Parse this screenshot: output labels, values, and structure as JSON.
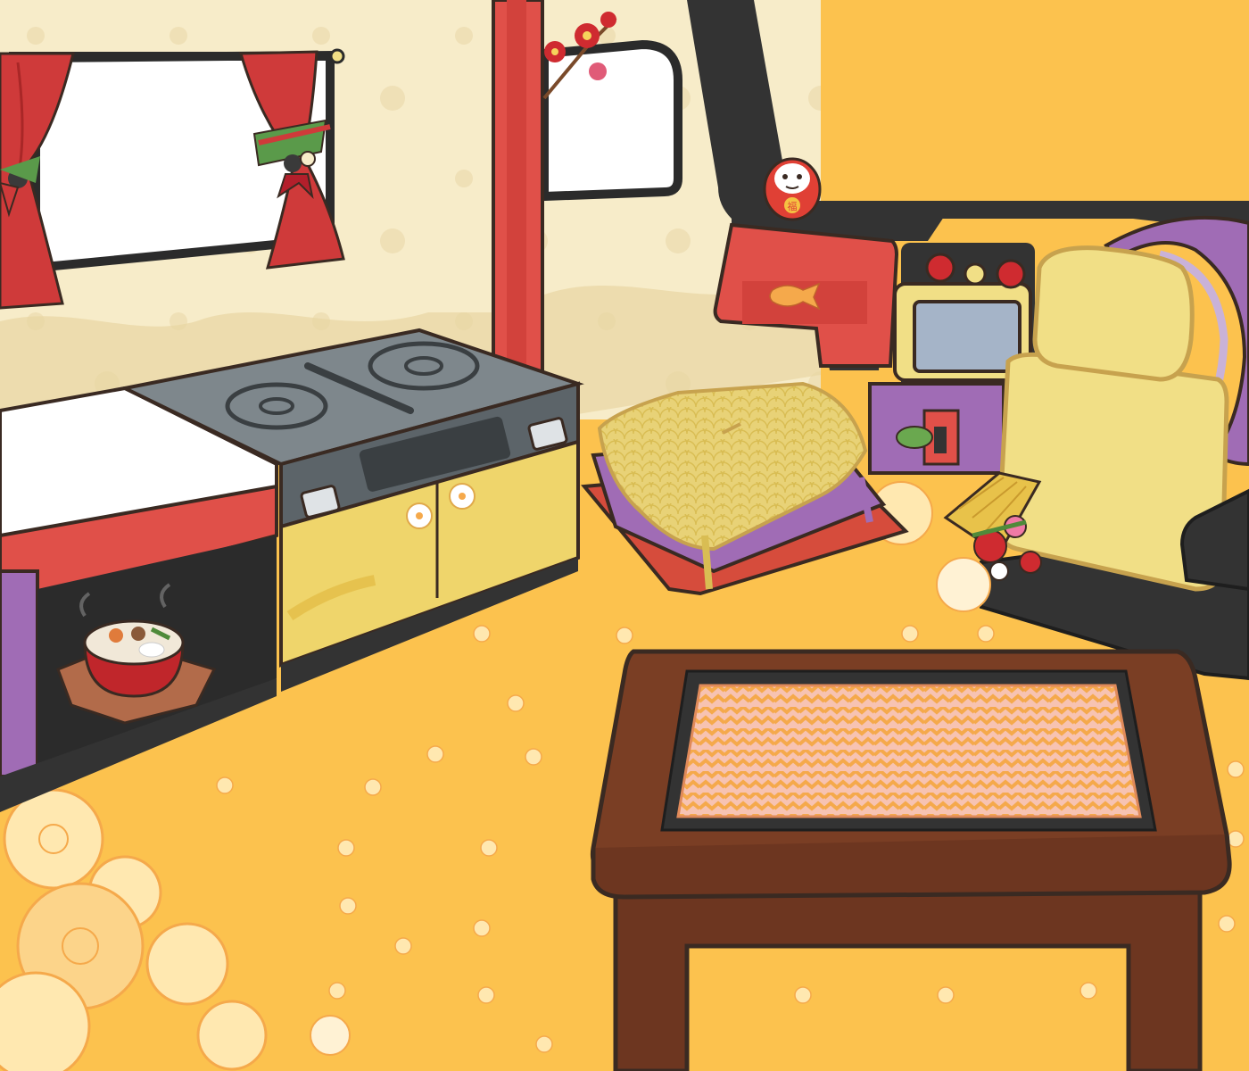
{
  "scene": {
    "daruma_glyph": "福",
    "colors": {
      "floor": "#fcc24e",
      "wall": "#f7ecc9",
      "pillar_red": "#e05049",
      "curtain_red": "#cf3a3a",
      "kitchen_yellow": "#efd56b",
      "stove_gray": "#7e878c",
      "cushion_yellow": "#e8d277",
      "cushion_purple": "#a06cb5",
      "cushion_red": "#d64c3c",
      "dashboard_black": "#333333",
      "seat_yellow": "#f1df86",
      "table_wood": "#7a3e24",
      "mat_pink": "#f7c3b2",
      "mat_orange": "#f5a94b",
      "outline": "#3a2a22"
    }
  }
}
